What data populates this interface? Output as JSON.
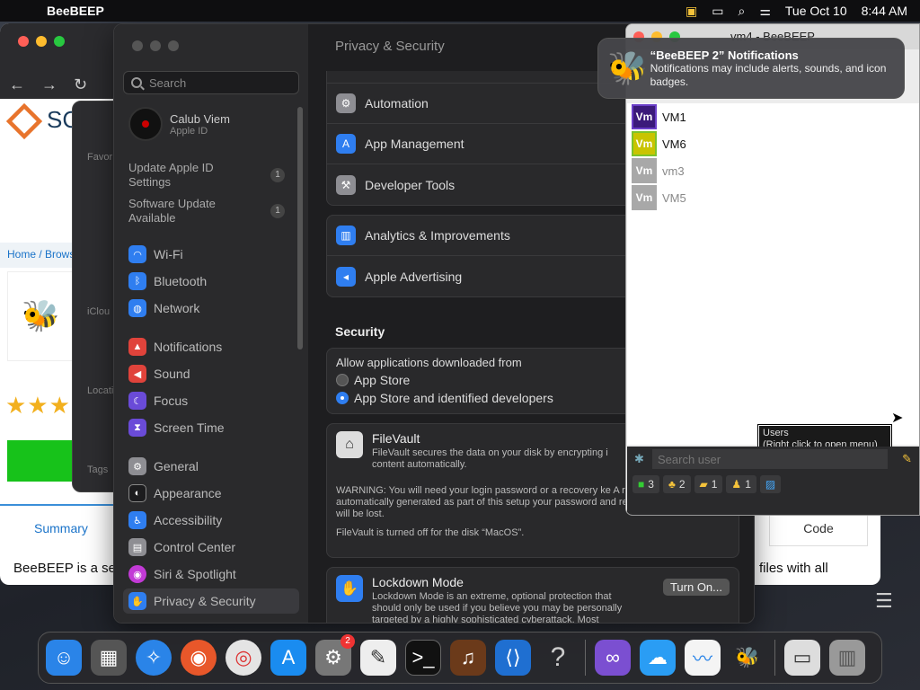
{
  "menubar": {
    "app_name": "BeeBEEP",
    "date": "Tue Oct 10",
    "time": "8:44 AM"
  },
  "browser": {
    "logo_text": "SC",
    "breadcrumb": "Home / Brows",
    "stars": "★★★",
    "summary_tab": "Summary",
    "code_tab": "Code",
    "body_text": "BeeBEEP is a se",
    "body_text_right": "files with all"
  },
  "finder": {
    "favorites": "Favor",
    "icloud": "iClou",
    "locations": "Locati",
    "tags": "Tags"
  },
  "settings": {
    "search_placeholder": "Search",
    "account_name": "Calub Viem",
    "account_sub": "Apple ID",
    "pending": [
      {
        "label": "Update Apple ID Settings",
        "count": "1"
      },
      {
        "label": "Software Update Available",
        "count": "1"
      }
    ],
    "sidebar": [
      {
        "label": "Wi-Fi",
        "color": "#2f7ef0"
      },
      {
        "label": "Bluetooth",
        "color": "#2f7ef0"
      },
      {
        "label": "Network",
        "color": "#2f7ef0"
      },
      {
        "label": "Notifications",
        "color": "#e0433b"
      },
      {
        "label": "Sound",
        "color": "#e0433b"
      },
      {
        "label": "Focus",
        "color": "#6a4bd8"
      },
      {
        "label": "Screen Time",
        "color": "#6a4bd8"
      },
      {
        "label": "General",
        "color": "#8e8e93"
      },
      {
        "label": "Appearance",
        "color": "#1c1c1e"
      },
      {
        "label": "Accessibility",
        "color": "#2f7ef0"
      },
      {
        "label": "Control Center",
        "color": "#8e8e93"
      },
      {
        "label": "Siri & Spotlight",
        "color": "#c23ad6"
      },
      {
        "label": "Privacy & Security",
        "color": "#2f7ef0"
      }
    ],
    "title": "Privacy & Security",
    "group1": [
      "Automation",
      "App Management",
      "Developer Tools"
    ],
    "group2": [
      "Analytics & Improvements",
      "Apple Advertising"
    ],
    "security_title": "Security",
    "allow_label": "Allow applications downloaded from",
    "radio_app_store": "App Store",
    "radio_identified": "App Store and identified developers",
    "filevault_title": "FileVault",
    "filevault_desc": "FileVault secures the data on your disk by encrypting i content automatically.",
    "filevault_warning": "WARNING: You will need your login password or a recovery ke A recovery key is automatically generated as part of this setup your password and recovery key, the data will be lost.",
    "filevault_status": "FileVault is turned off for the disk “MacOS”.",
    "lockdown_title": "Lockdown Mode",
    "lockdown_desc": "Lockdown Mode is an extreme, optional protection that should only be used if you believe you may be personally targeted by a highly sophisticated cyberattack. Most",
    "turn_on": "Turn On..."
  },
  "beebeep": {
    "title": "vm4 - BeeBEEP",
    "users": [
      {
        "initials": "Vm",
        "name": "VM1",
        "color": "#3b1a7a",
        "online": true
      },
      {
        "initials": "Vm",
        "name": "VM6",
        "color": "#c9c400",
        "online": true
      },
      {
        "initials": "Vm",
        "name": "vm3",
        "color": "#a8a8a8",
        "online": false
      },
      {
        "initials": "Vm",
        "name": "VM5",
        "color": "#a8a8a8",
        "online": false
      }
    ],
    "tooltip_line1": "Users",
    "tooltip_line2": "(Right click to open menu)",
    "search_placeholder": "Search user",
    "status": [
      "3",
      "2",
      "1",
      "1",
      ""
    ]
  },
  "notification": {
    "title": "“BeeBEEP 2” Notifications",
    "message": "Notifications may include alerts, sounds, and icon badges."
  },
  "dock": {
    "settings_badge": "2",
    "items": [
      "finder-icon",
      "launchpad-icon",
      "safari-icon",
      "firefox-icon",
      "chrome-icon",
      "app-store-icon",
      "system-settings-icon",
      "textedit-icon",
      "terminal-icon",
      "guitar-icon",
      "vscode-icon",
      "help-icon",
      "visual-studio-icon",
      "weather-icon",
      "freeform-icon",
      "beebeep-icon",
      "screenshot-icon",
      "trash-icon"
    ]
  }
}
